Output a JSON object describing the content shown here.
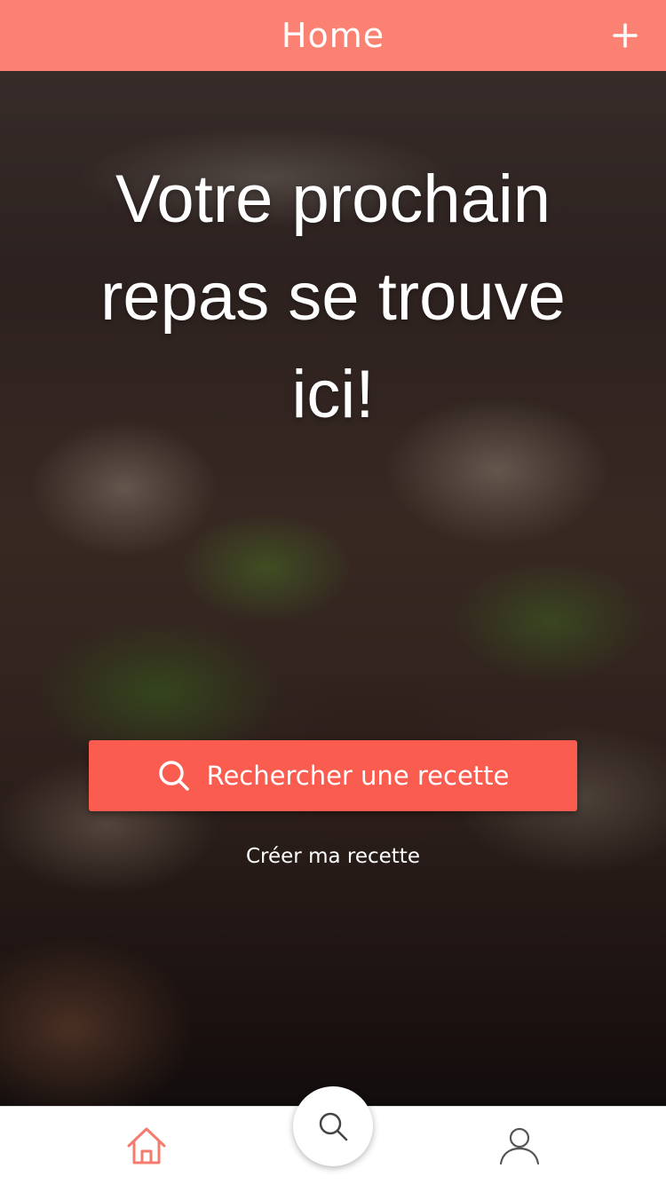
{
  "header": {
    "title": "Home",
    "add_icon": "plus-icon"
  },
  "hero": {
    "title": "Votre prochain repas se trouve ici!",
    "search_button_label": "Rechercher une recette",
    "search_icon": "search-icon",
    "create_link_label": "Créer ma recette"
  },
  "tabbar": {
    "items": [
      {
        "name": "home",
        "icon": "home-icon",
        "active": true
      },
      {
        "name": "search",
        "icon": "search-icon",
        "active": false
      },
      {
        "name": "profile",
        "icon": "user-icon",
        "active": false
      }
    ]
  },
  "colors": {
    "header_bg": "#fb8272",
    "button_bg": "#fb5c50",
    "active_tab": "#f47c6e",
    "inactive_tab": "#555555"
  }
}
